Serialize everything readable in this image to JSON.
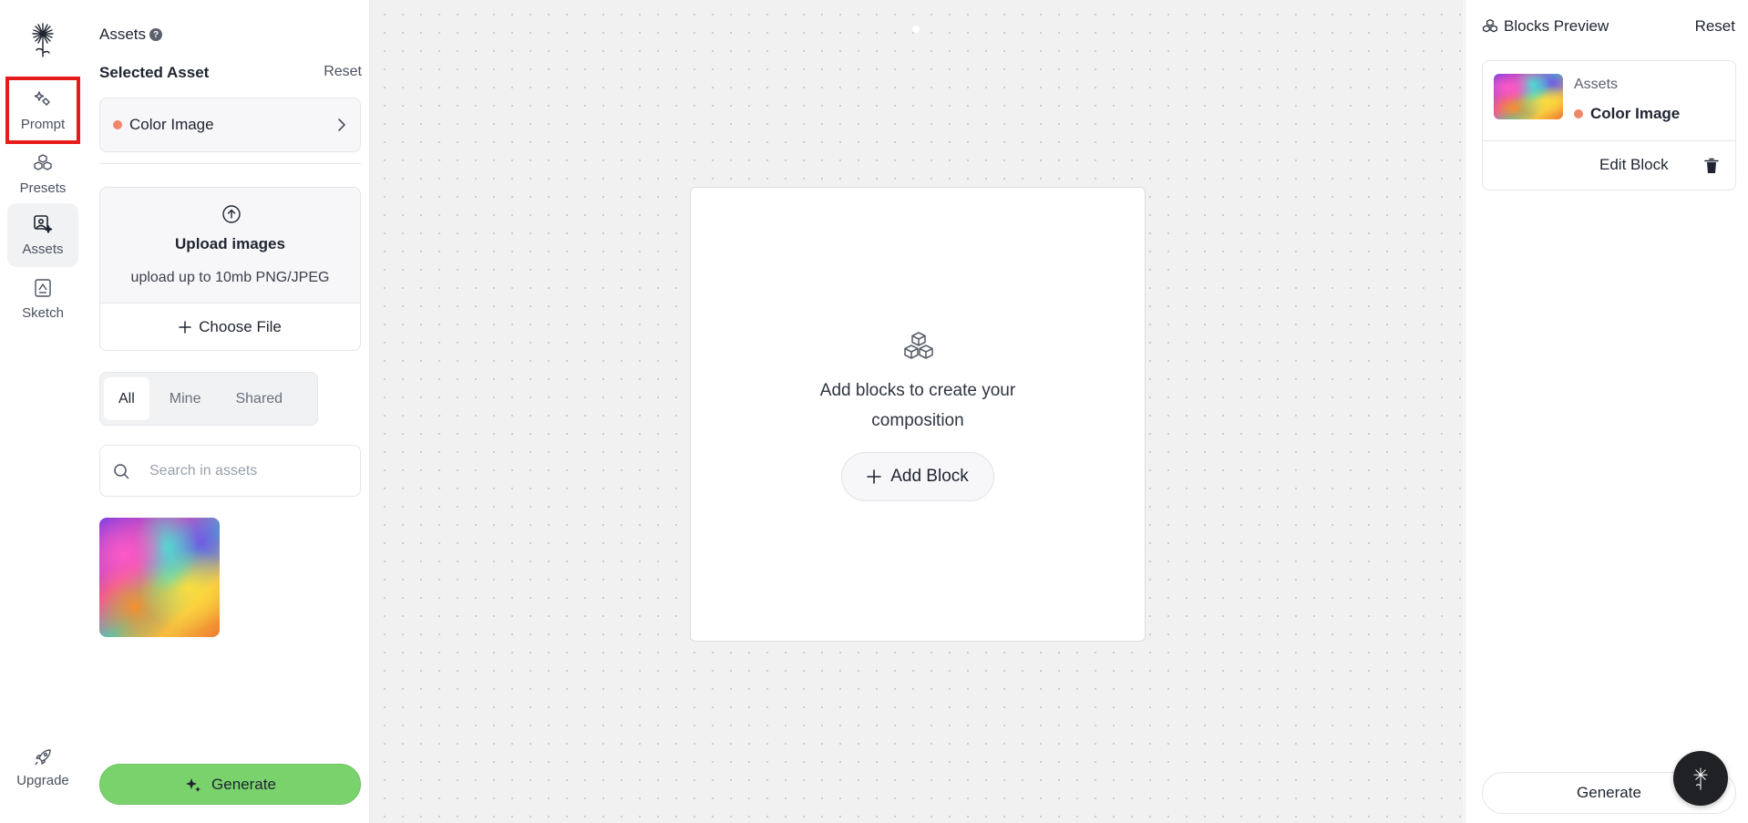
{
  "rail": {
    "items": [
      {
        "key": "prompt",
        "label": "Prompt",
        "icon": "sparkle-wand-icon"
      },
      {
        "key": "presets",
        "label": "Presets",
        "icon": "cubes-icon"
      },
      {
        "key": "assets",
        "label": "Assets",
        "icon": "image-sparkle-icon"
      },
      {
        "key": "sketch",
        "label": "Sketch",
        "icon": "sketch-icon"
      }
    ],
    "active": "assets",
    "highlighted": "prompt",
    "upgrade_label": "Upgrade"
  },
  "assets_panel": {
    "title": "Assets",
    "help": "?",
    "selected_heading": "Selected Asset",
    "reset_label": "Reset",
    "selected_asset": {
      "name": "Color Image",
      "dot_color": "#f0876b"
    },
    "upload": {
      "title": "Upload images",
      "subtitle": "upload up to 10mb PNG/JPEG",
      "choose_label": "Choose File"
    },
    "filters": [
      "All",
      "Mine",
      "Shared"
    ],
    "active_filter": "All",
    "search": {
      "placeholder": "Search in assets",
      "value": ""
    },
    "generate_label": "Generate"
  },
  "canvas": {
    "empty_text": "Add blocks to create your composition",
    "add_block_label": "Add Block"
  },
  "blocks_preview": {
    "title": "Blocks Preview",
    "reset_label": "Reset",
    "block": {
      "category": "Assets",
      "name": "Color Image",
      "edit_label": "Edit Block"
    },
    "generate_label": "Generate"
  },
  "colors": {
    "accent_green": "#7ad26d",
    "highlight_red": "#e81b1b",
    "asset_dot": "#f0876b"
  }
}
